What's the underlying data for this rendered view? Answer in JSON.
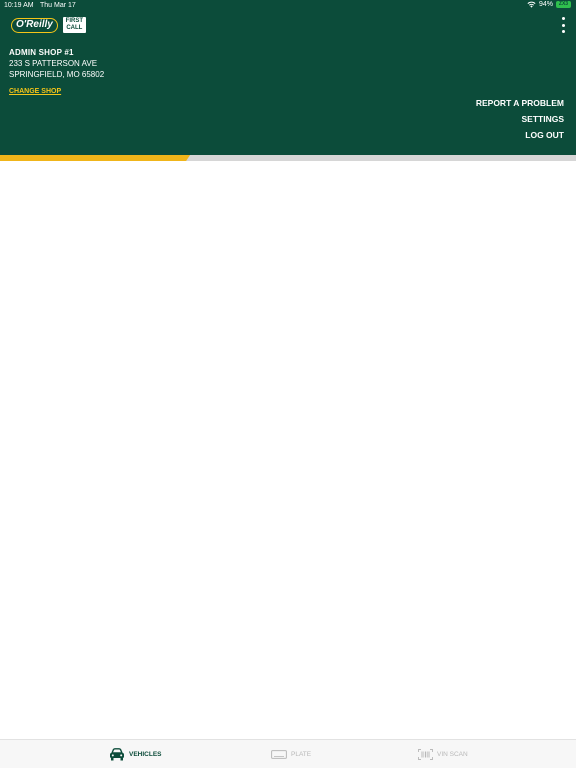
{
  "status_bar": {
    "time": "10:19 AM",
    "date": "Thu Mar 17",
    "battery_percent": "94%",
    "battery_badge": "ZX3"
  },
  "logo": {
    "brand": "O'Reilly",
    "sub_brand": "FIRST CALL"
  },
  "shop": {
    "name": "ADMIN SHOP #1",
    "address_line1": "233 S PATTERSON AVE",
    "address_line2": "SPRINGFIELD, MO 65802",
    "change_label": "CHANGE SHOP"
  },
  "menu": {
    "report": "REPORT A PROBLEM",
    "settings": "SETTINGS",
    "logout": "LOG OUT"
  },
  "progress": {
    "fraction": 0.33
  },
  "tabs": [
    {
      "label": "VEHICLES",
      "icon": "car-icon",
      "active": true
    },
    {
      "label": "PLATE",
      "icon": "license-plate-icon",
      "active": false
    },
    {
      "label": "VIN SCAN",
      "icon": "barcode-scan-icon",
      "active": false
    }
  ],
  "colors": {
    "header": "#0c4c3a",
    "accent": "#f5c518",
    "progress": "#f0b51a",
    "inactive_tab": "#b8b8b8"
  }
}
